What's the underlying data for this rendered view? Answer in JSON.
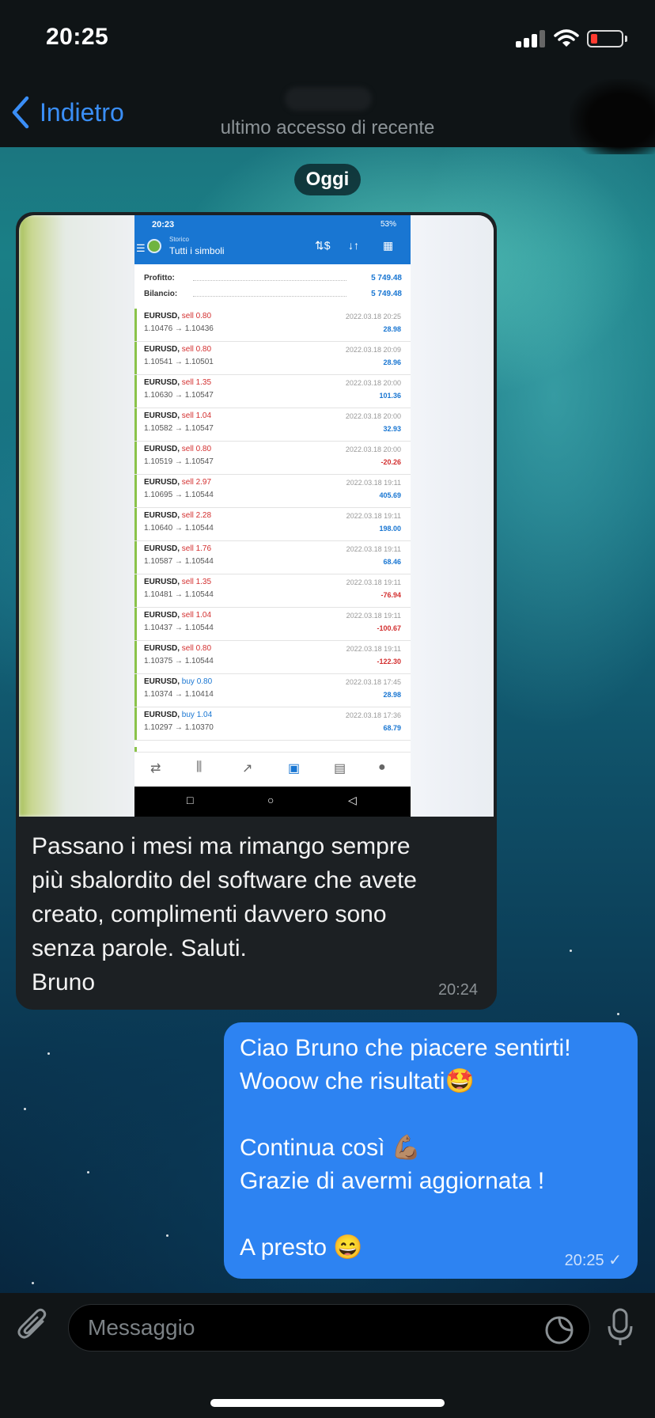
{
  "status_bar": {
    "time": "20:25"
  },
  "nav": {
    "back_label": "Indietro",
    "last_seen": "ultimo accesso di recente"
  },
  "date_separator": "Oggi",
  "incoming": {
    "text": "Passano i mesi ma rimango sempre\npiù sbalordito del software che avete\ncreato, complimenti davvero sono\nsenza parole. Saluti.\nBruno",
    "time": "20:24",
    "screenshot": {
      "time": "20:23",
      "status": "53%",
      "app_subtitle": "Storico",
      "app_title": "Tutti i simboli",
      "summary": [
        {
          "label": "Profitto:",
          "value": "5 749.48"
        },
        {
          "label": "Bilancio:",
          "value": "5 749.48"
        }
      ],
      "trades": [
        {
          "symbol": "EURUSD,",
          "action": "sell 0.80",
          "type": "sell",
          "prices": "1.10476 → 1.10436",
          "datetime": "2022.03.18 20:25",
          "profit": "28.98",
          "sign": "pos"
        },
        {
          "symbol": "EURUSD,",
          "action": "sell 0.80",
          "type": "sell",
          "prices": "1.10541 → 1.10501",
          "datetime": "2022.03.18 20:09",
          "profit": "28.96",
          "sign": "pos"
        },
        {
          "symbol": "EURUSD,",
          "action": "sell 1.35",
          "type": "sell",
          "prices": "1.10630 → 1.10547",
          "datetime": "2022.03.18 20:00",
          "profit": "101.36",
          "sign": "pos"
        },
        {
          "symbol": "EURUSD,",
          "action": "sell 1.04",
          "type": "sell",
          "prices": "1.10582 → 1.10547",
          "datetime": "2022.03.18 20:00",
          "profit": "32.93",
          "sign": "pos"
        },
        {
          "symbol": "EURUSD,",
          "action": "sell 0.80",
          "type": "sell",
          "prices": "1.10519 → 1.10547",
          "datetime": "2022.03.18 20:00",
          "profit": "-20.26",
          "sign": "neg"
        },
        {
          "symbol": "EURUSD,",
          "action": "sell 2.97",
          "type": "sell",
          "prices": "1.10695 → 1.10544",
          "datetime": "2022.03.18 19:11",
          "profit": "405.69",
          "sign": "pos"
        },
        {
          "symbol": "EURUSD,",
          "action": "sell 2.28",
          "type": "sell",
          "prices": "1.10640 → 1.10544",
          "datetime": "2022.03.18 19:11",
          "profit": "198.00",
          "sign": "pos"
        },
        {
          "symbol": "EURUSD,",
          "action": "sell 1.76",
          "type": "sell",
          "prices": "1.10587 → 1.10544",
          "datetime": "2022.03.18 19:11",
          "profit": "68.46",
          "sign": "pos"
        },
        {
          "symbol": "EURUSD,",
          "action": "sell 1.35",
          "type": "sell",
          "prices": "1.10481 → 1.10544",
          "datetime": "2022.03.18 19:11",
          "profit": "-76.94",
          "sign": "neg"
        },
        {
          "symbol": "EURUSD,",
          "action": "sell 1.04",
          "type": "sell",
          "prices": "1.10437 → 1.10544",
          "datetime": "2022.03.18 19:11",
          "profit": "-100.67",
          "sign": "neg"
        },
        {
          "symbol": "EURUSD,",
          "action": "sell 0.80",
          "type": "sell",
          "prices": "1.10375 → 1.10544",
          "datetime": "2022.03.18 19:11",
          "profit": "-122.30",
          "sign": "neg"
        },
        {
          "symbol": "EURUSD,",
          "action": "buy 0.80",
          "type": "buy",
          "prices": "1.10374 → 1.10414",
          "datetime": "2022.03.18 17:45",
          "profit": "28.98",
          "sign": "pos"
        },
        {
          "symbol": "EURUSD,",
          "action": "buy 1.04",
          "type": "buy",
          "prices": "1.10297 → 1.10370",
          "datetime": "2022.03.18 17:36",
          "profit": "68.79",
          "sign": "pos"
        }
      ]
    }
  },
  "outgoing": {
    "text": "Ciao Bruno che piacere sentirti!\nWooow che risultati🤩\n\nContinua così 💪🏽\nGrazie di avermi aggiornata !\n\nA presto 😄",
    "time": "20:25",
    "read_mark": "✓"
  },
  "composer": {
    "placeholder": "Messaggio"
  },
  "colors": {
    "accent": "#3a8ef6",
    "outgoing_bubble": "#2d83f2",
    "incoming_bubble": "#1c2023"
  }
}
